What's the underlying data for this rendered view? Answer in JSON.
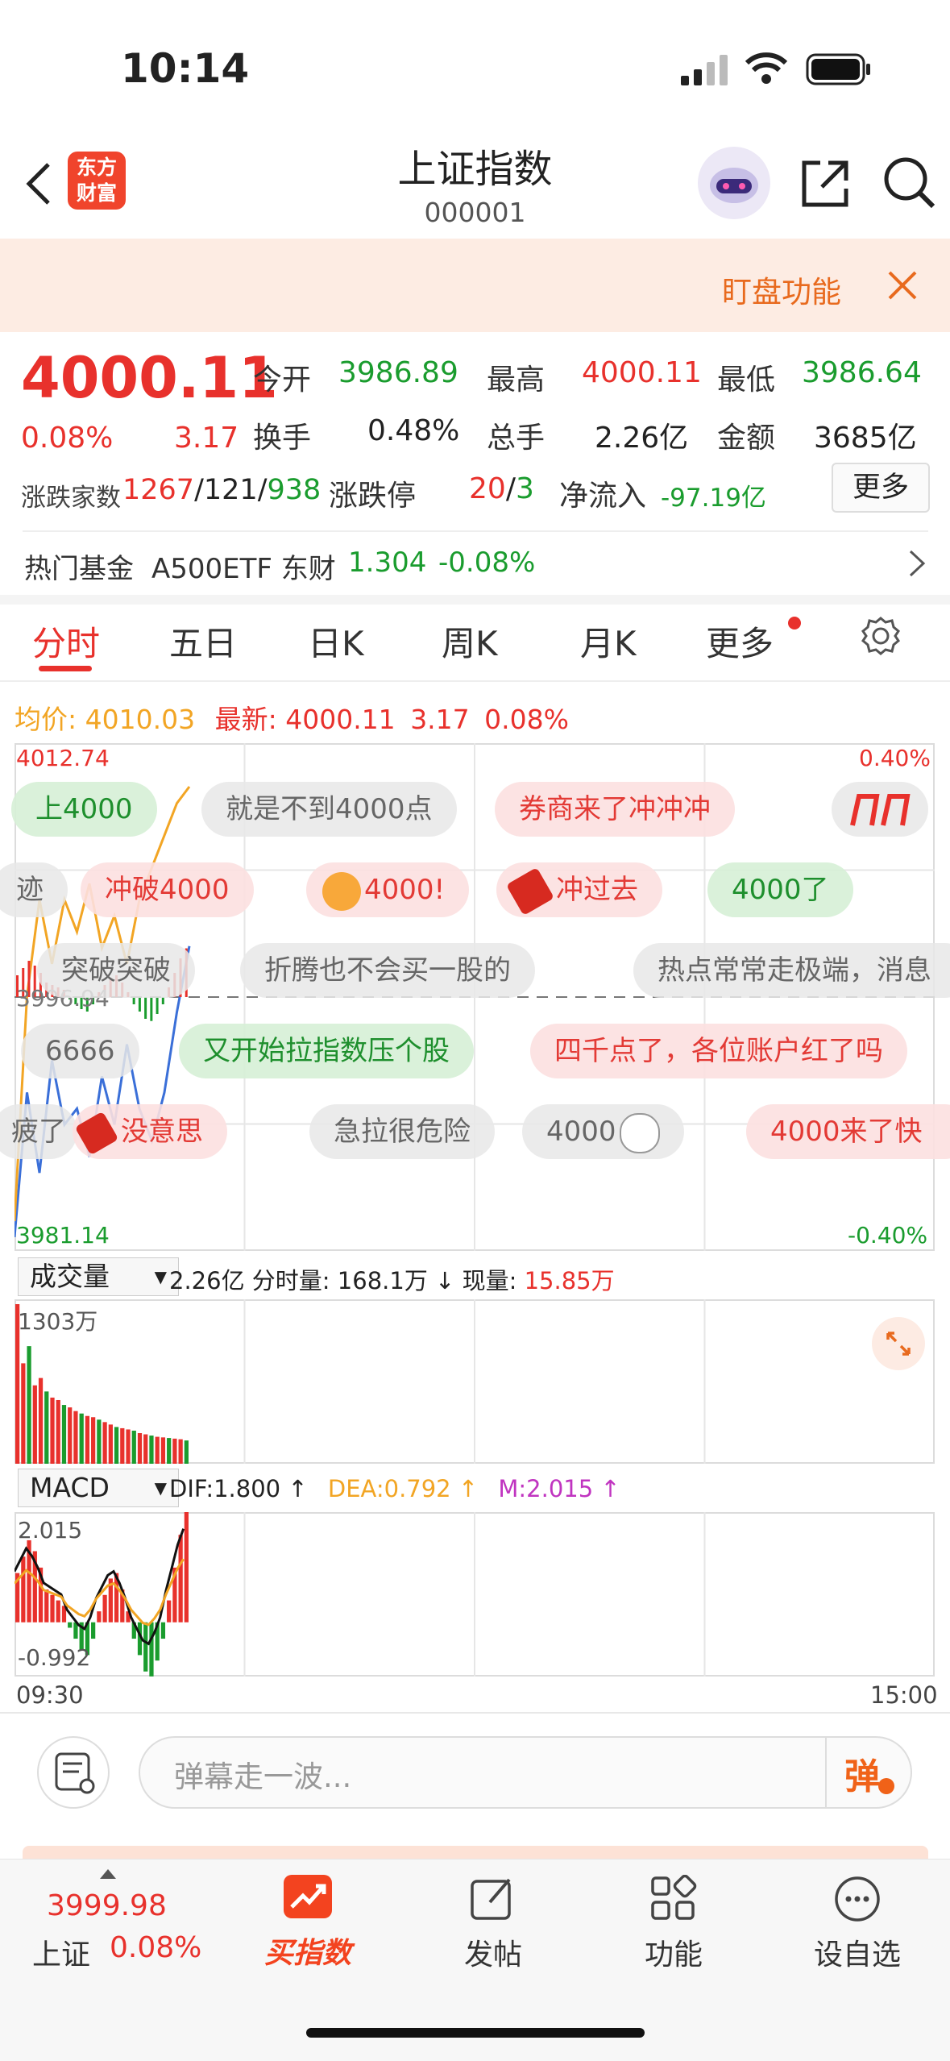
{
  "status": {
    "time": "10:14"
  },
  "nav": {
    "title": "上证指数",
    "code": "000001",
    "logo_line1": "东方",
    "logo_line2": "财富"
  },
  "banner": {
    "text": "盯盘功能"
  },
  "quote": {
    "price": "4000.11",
    "change_pct": "0.08%",
    "change": "3.17",
    "open_label": "今开",
    "open": "3986.89",
    "high_label": "最高",
    "high": "4000.11",
    "low_label": "最低",
    "low": "3986.64",
    "turnover_label": "换手",
    "turnover": "0.48%",
    "volume_label": "总手",
    "volume": "2.26亿",
    "amount_label": "金额",
    "amount": "3685亿",
    "breadth_label": "涨跌家数",
    "up": "1267",
    "flat": "121",
    "down": "938",
    "limit_label": "涨跌停",
    "limit_up": "20",
    "limit_down": "3",
    "inflow_label": "净流入",
    "inflow": "-97.19亿",
    "more_button": "更多"
  },
  "hot_fund": {
    "label": "热门基金",
    "name": "A500ETF 东财",
    "price": "1.304",
    "pct": "-0.08%"
  },
  "tabs": [
    "分时",
    "五日",
    "日K",
    "周K",
    "月K",
    "更多"
  ],
  "chart_header": {
    "avg_label": "均价:",
    "avg": "4010.03",
    "last_label": "最新:",
    "last": "4000.11",
    "change": "3.17",
    "pct": "0.08%"
  },
  "price_axis": {
    "top": "4012.74",
    "mid": "3996.94",
    "bottom": "3981.14",
    "top_pct": "0.40%",
    "bottom_pct": "-0.40%"
  },
  "danmaku": [
    {
      "text": "上4000",
      "style": "green"
    },
    {
      "text": "就是不到4000点",
      "style": "gray"
    },
    {
      "text": "券商来了冲冲冲",
      "style": "red"
    },
    {
      "text": "冲破4000",
      "style": "red"
    },
    {
      "text": "4000!",
      "style": "red"
    },
    {
      "text": "冲过去",
      "style": "red"
    },
    {
      "text": "4000了",
      "style": "green"
    },
    {
      "text": "突破突破",
      "style": "gray"
    },
    {
      "text": "折腾也不会买一股的",
      "style": "gray"
    },
    {
      "text": "热点常常走极端，消息",
      "style": "gray"
    },
    {
      "text": "6666",
      "style": "gray"
    },
    {
      "text": "又开始拉指数压个股",
      "style": "green"
    },
    {
      "text": "四千点了，各位账户红了吗",
      "style": "red"
    },
    {
      "text": "没意思",
      "style": "red"
    },
    {
      "text": "急拉很危险",
      "style": "gray"
    },
    {
      "text": "4000",
      "style": "gray"
    },
    {
      "text": "4000来了快",
      "style": "red"
    },
    {
      "text": "迹",
      "style": "gray"
    },
    {
      "text": "疲了",
      "style": "gray"
    }
  ],
  "volume_panel": {
    "select": "成交量",
    "total": "2.26亿",
    "minute_label": "分时量:",
    "minute": "168.1万",
    "now_label": "现量:",
    "now": "15.85万",
    "max": "1303万"
  },
  "macd_panel": {
    "select": "MACD",
    "dif": "DIF:1.800",
    "dea": "DEA:0.792",
    "m": "M:2.015",
    "max": "2.015",
    "min": "-0.992"
  },
  "time_axis": {
    "start": "09:30",
    "end": "15:00"
  },
  "comment": {
    "placeholder": "弹幕走一波...",
    "button": "弹"
  },
  "tabbar": {
    "index_price": "3999.98",
    "index_name": "上证",
    "index_pct": "0.08%",
    "items": [
      "买指数",
      "发帖",
      "功能",
      "设自选"
    ]
  },
  "colors": {
    "up": "#e8312c",
    "down": "#1a9c2e",
    "accent": "#ff6a00",
    "avg_line": "#f2a524",
    "price_line": "#3a6fd8"
  },
  "chart_data": [
    {
      "type": "line",
      "x_range": [
        "09:30",
        "15:00"
      ],
      "ylim": [
        3981.14,
        4012.74
      ],
      "series": [
        {
          "name": "最新",
          "values": [
            3982,
            3991,
            3986,
            3993,
            3989,
            3990,
            3987,
            3992,
            3989,
            3994,
            3990,
            3988,
            3991,
            3996,
            4000.11
          ]
        },
        {
          "name": "均价",
          "values": [
            3983,
            3997,
            4003,
            3999,
            4003,
            4001,
            4004,
            4000,
            4002,
            3999,
            4003,
            4005,
            4007,
            4009,
            4010.03
          ]
        }
      ]
    },
    {
      "type": "bar",
      "ylim": [
        0,
        1303
      ],
      "values": [
        1303,
        820,
        960,
        640,
        700,
        590,
        540,
        520,
        480,
        460,
        430,
        410,
        390,
        380,
        360,
        340,
        320,
        300,
        290,
        280,
        270,
        250,
        240,
        230,
        220,
        215,
        210,
        205,
        200,
        190
      ]
    },
    {
      "type": "bar",
      "ylim": [
        -0.992,
        2.015
      ],
      "values": [
        0.9,
        1.2,
        1.5,
        1.3,
        1.0,
        0.6,
        0.5,
        0.4,
        0.3,
        -0.1,
        -0.3,
        -0.5,
        -0.6,
        -0.3,
        0.2,
        0.5,
        0.8,
        0.9,
        0.6,
        0.2,
        -0.3,
        -0.6,
        -0.9,
        -0.99,
        -0.7,
        -0.3,
        0.4,
        1.0,
        1.6,
        2.015
      ]
    }
  ]
}
